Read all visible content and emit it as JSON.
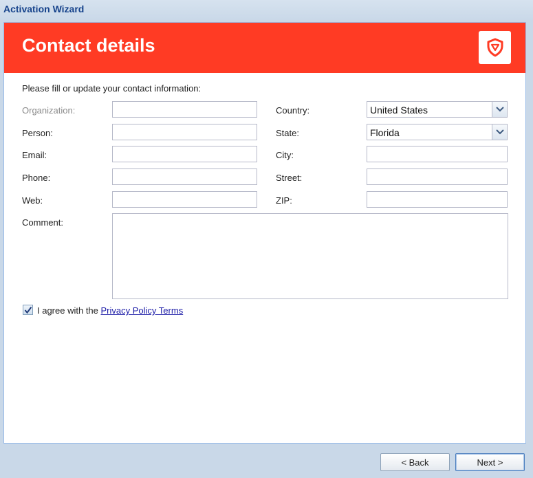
{
  "window": {
    "title": "Activation Wizard"
  },
  "header": {
    "heading": "Contact details",
    "logo_icon": "shield-icon",
    "accent": "#ff3b24"
  },
  "form": {
    "intro": "Please fill or update your contact information:",
    "organization": {
      "label": "Organization:",
      "value": ""
    },
    "person": {
      "label": "Person:",
      "value": ""
    },
    "email": {
      "label": "Email:",
      "value": ""
    },
    "phone": {
      "label": "Phone:",
      "value": ""
    },
    "web": {
      "label": "Web:",
      "value": ""
    },
    "country": {
      "label": "Country:",
      "value": "United States"
    },
    "state": {
      "label": "State:",
      "value": "Florida"
    },
    "city": {
      "label": "City:",
      "value": ""
    },
    "street": {
      "label": "Street:",
      "value": ""
    },
    "zip": {
      "label": "ZIP:",
      "value": ""
    },
    "comment": {
      "label": "Comment:",
      "value": ""
    },
    "agree": {
      "checked": true,
      "text": "I agree with the",
      "link": "Privacy Policy Terms"
    }
  },
  "footer": {
    "back_label": "< Back",
    "next_label": "Next >"
  }
}
